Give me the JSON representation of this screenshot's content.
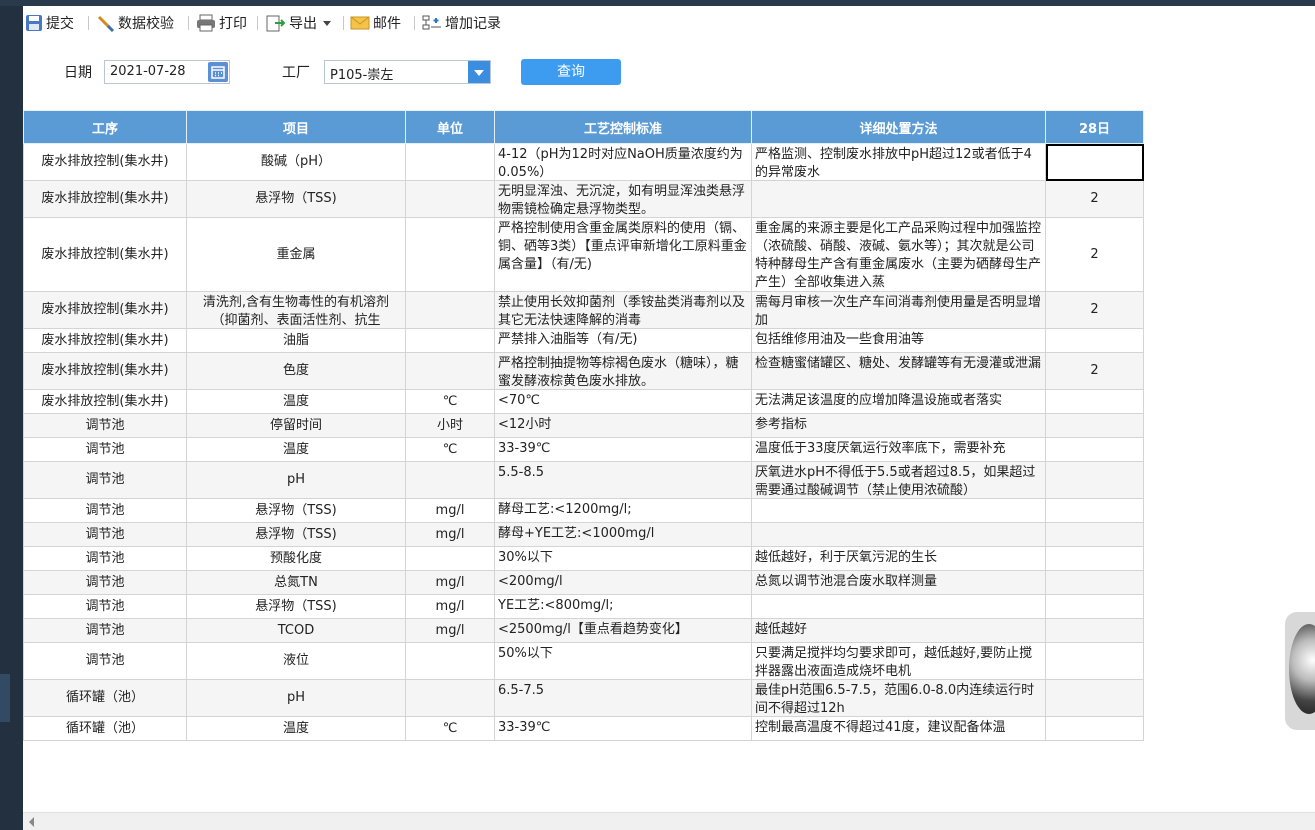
{
  "toolbar": {
    "submit": "提交",
    "validate": "数据校验",
    "print": "打印",
    "export": "导出",
    "mail": "邮件",
    "add_record": "增加记录"
  },
  "filter": {
    "date_label": "日期",
    "date_value": "2021-07-28",
    "factory_label": "工厂",
    "factory_value": "P105-崇左",
    "query_label": "查询"
  },
  "grid": {
    "headers": [
      "工序",
      "项目",
      "单位",
      "工艺控制标准",
      "详细处置方法",
      "28日"
    ],
    "rows": [
      {
        "process": "废水排放控制(集水井)",
        "item": "酸碱（pH）",
        "unit": "",
        "standard": "4-12（pH为12时对应NaOH质量浓度约为0.05%）",
        "method": "严格监测、控制废水排放中pH超过12或者低于4的异常废水",
        "value": ""
      },
      {
        "process": "废水排放控制(集水井)",
        "item": "悬浮物（TSS)",
        "unit": "",
        "standard": "无明显浑浊、无沉淀，如有明显浑浊类悬浮物需镜检确定悬浮物类型。",
        "method": "",
        "value": "2"
      },
      {
        "process": "废水排放控制(集水井)",
        "item": "重金属",
        "unit": "",
        "standard": "严格控制使用含重金属类原料的使用（镉、铜、硒等3类）【重点评审新增化工原料重金属含量】（有/无)",
        "method": "重金属的来源主要是化工产品采购过程中加强监控（浓硫酸、硝酸、液碱、氨水等）；其次就是公司特种酵母生产含有重金属废水（主要为硒酵母生产产生）全部收集进入蒸",
        "value": "2"
      },
      {
        "process": "废水排放控制(集水井)",
        "item": "清洗剂,含有生物毒性的有机溶剂（抑菌剂、表面活性剂、抗生",
        "unit": "",
        "standard": "禁止使用长效抑菌剂（季铵盐类消毒剂以及其它无法快速降解的消毒",
        "method": "需每月审核一次生产车间消毒剂使用量是否明显增加",
        "value": "2"
      },
      {
        "process": "废水排放控制(集水井)",
        "item": "油脂",
        "unit": "",
        "standard": "严禁排入油脂等（有/无)",
        "method": "包括维修用油及一些食用油等",
        "value": ""
      },
      {
        "process": "废水排放控制(集水井)",
        "item": "色度",
        "unit": "",
        "standard": "严格控制抽提物等棕褐色废水（糖味），糖蜜发酵液棕黄色废水排放。",
        "method": "检查糖蜜储罐区、糖处、发酵罐等有无漫灌或泄漏",
        "value": "2"
      },
      {
        "process": "废水排放控制(集水井)",
        "item": "温度",
        "unit": "℃",
        "standard": "<70℃",
        "method": "无法满足该温度的应增加降温设施或者落实",
        "value": ""
      },
      {
        "process": "调节池",
        "item": "停留时间",
        "unit": "小时",
        "standard": "<12小时",
        "method": "参考指标",
        "value": ""
      },
      {
        "process": "调节池",
        "item": "温度",
        "unit": "℃",
        "standard": "33-39℃",
        "method": "温度低于33度厌氧运行效率底下，需要补充",
        "value": ""
      },
      {
        "process": "调节池",
        "item": "pH",
        "unit": "",
        "standard": "5.5-8.5",
        "method": "厌氧进水pH不得低于5.5或者超过8.5，如果超过需要通过酸碱调节（禁止使用浓硫酸）",
        "value": ""
      },
      {
        "process": "调节池",
        "item": "悬浮物（TSS)",
        "unit": "mg/l",
        "standard": "酵母工艺:<1200mg/l;",
        "method": "",
        "value": ""
      },
      {
        "process": "调节池",
        "item": "悬浮物（TSS)",
        "unit": "mg/l",
        "standard": "酵母+YE工艺:<1000mg/l",
        "method": "",
        "value": ""
      },
      {
        "process": "调节池",
        "item": "预酸化度",
        "unit": "",
        "standard": "30%以下",
        "method": "越低越好，利于厌氧污泥的生长",
        "value": ""
      },
      {
        "process": "调节池",
        "item": "总氮TN",
        "unit": "mg/l",
        "standard": "<200mg/l",
        "method": "总氮以调节池混合废水取样测量",
        "value": ""
      },
      {
        "process": "调节池",
        "item": "悬浮物（TSS)",
        "unit": "mg/l",
        "standard": "YE工艺:<800mg/l;",
        "method": "",
        "value": ""
      },
      {
        "process": "调节池",
        "item": "TCOD",
        "unit": "mg/l",
        "standard": "<2500mg/l【重点看趋势变化】",
        "method": "越低越好",
        "value": ""
      },
      {
        "process": "调节池",
        "item": "液位",
        "unit": "",
        "standard": "50%以下",
        "method": "只要满足搅拌均匀要求即可，越低越好,要防止搅拌器露出液面造成烧坏电机",
        "value": ""
      },
      {
        "process": "循环罐（池）",
        "item": "pH",
        "unit": "",
        "standard": "6.5-7.5",
        "method": "最佳pH范围6.5-7.5，范围6.0-8.0内连续运行时间不得超过12h",
        "value": ""
      },
      {
        "process": "循环罐（池）",
        "item": "温度",
        "unit": "℃",
        "standard": "33-39℃",
        "method": "控制最高温度不得超过41度，建议配备体温",
        "value": ""
      }
    ]
  }
}
